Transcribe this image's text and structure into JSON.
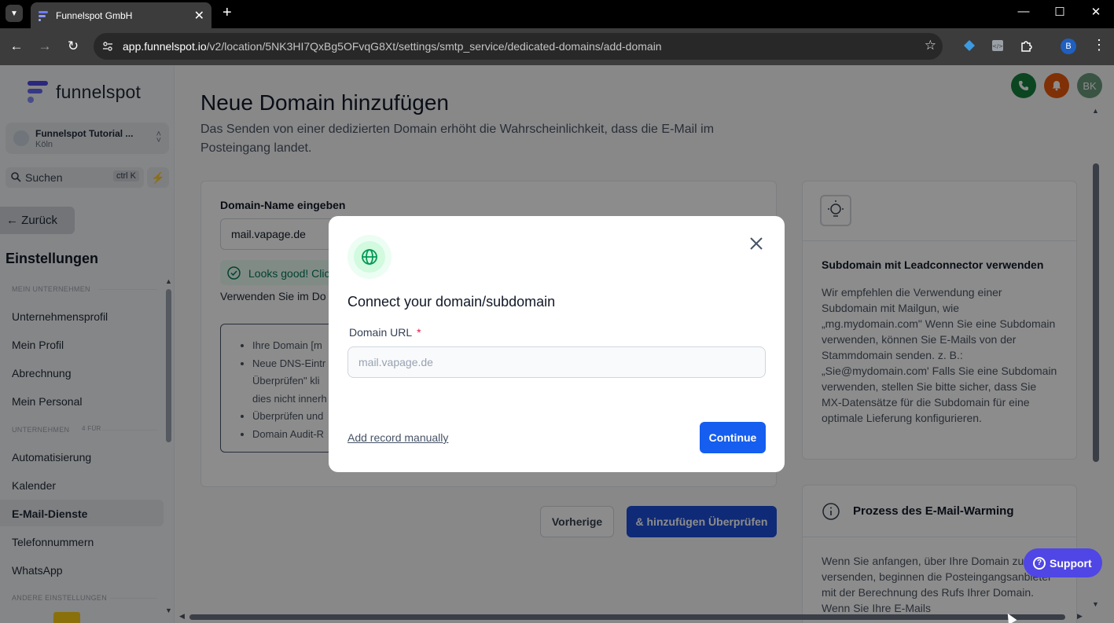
{
  "browser": {
    "tab_title": "Funnelspot GmbH",
    "url_host": "app.funnelspot.io",
    "url_path": "/v2/location/5NK3HI7QxBg5OFvqG8Xt/settings/smtp_service/dedicated-domains/add-domain",
    "profile_initial": "B"
  },
  "sidebar": {
    "logo_text": "funnelspot",
    "location_name": "Funnelspot Tutorial ...",
    "location_city": "Köln",
    "search_label": "Suchen",
    "search_shortcut": "ctrl K",
    "back_label": "Zurück",
    "settings_title": "Einstellungen",
    "section_company": "MEIN UNTERNEHMEN",
    "section_business": "UNTERNEHMEN",
    "section_business_suffix": "4 FÜR",
    "section_other": "ANDERE EINSTELLUNGEN",
    "company_items": [
      "Unternehmensprofil",
      "Mein Profil",
      "Abrechnung",
      "Mein Personal"
    ],
    "business_items": [
      "Automatisierung",
      "Kalender",
      "E-Mail-Dienste",
      "Telefonnummern",
      "WhatsApp"
    ],
    "active_item": "E-Mail-Dienste"
  },
  "header": {
    "user_initials": "BK"
  },
  "main": {
    "title": "Neue Domain hinzufügen",
    "description": "Das Senden von einer dedizierten Domain erhöht die Wahrscheinlichkeit, dass die E-Mail im Posteingang landet.",
    "domain_label": "Domain-Name eingeben",
    "domain_value": "mail.vapage.de",
    "good_message": "Looks good! Clic",
    "use_text": "Verwenden Sie im Do",
    "steps": [
      "Ihre Domain [m",
      "Neue DNS-Eintr",
      "Überprüfen\" kli",
      "dies nicht innerh",
      "Überprüfen und",
      "Domain Audit-R"
    ],
    "prev_button": "Vorherige",
    "add_button": "& hinzufügen Überprüfen"
  },
  "right_panel": {
    "subdomain_title": "Subdomain mit Leadconnector verwenden",
    "subdomain_body": "Wir empfehlen die Verwendung einer Subdomain mit Mailgun, wie „mg.mydomain.com\" Wenn Sie eine Subdomain verwenden, können Sie E-Mails von der Stammdomain senden. z. B.: „Sie@mydomain.com' Falls Sie eine Subdomain verwenden, stellen Sie bitte sicher, dass Sie MX-Datensätze für die Subdomain für eine optimale Lieferung konfigurieren.",
    "warming_title": "Prozess des E-Mail-Warming",
    "warming_body": "Wenn Sie anfangen, über Ihre Domain zu versenden, beginnen die Posteingangsanbieter mit der Berechnung des Rufs Ihrer Domain. Wenn Sie Ihre E-Mails"
  },
  "support_label": "Support",
  "modal": {
    "title": "Connect your domain/subdomain",
    "field_label": "Domain URL",
    "required_mark": "*",
    "placeholder": "mail.vapage.de",
    "manual_link": "Add record manually",
    "continue_button": "Continue"
  },
  "colors": {
    "primary": "#155eef",
    "add_button": "#1d4ed8",
    "success": "#047857",
    "support": "#4f46e5",
    "phone": "#15803d",
    "bell": "#ea580c",
    "avatar": "#6b9a7a"
  }
}
